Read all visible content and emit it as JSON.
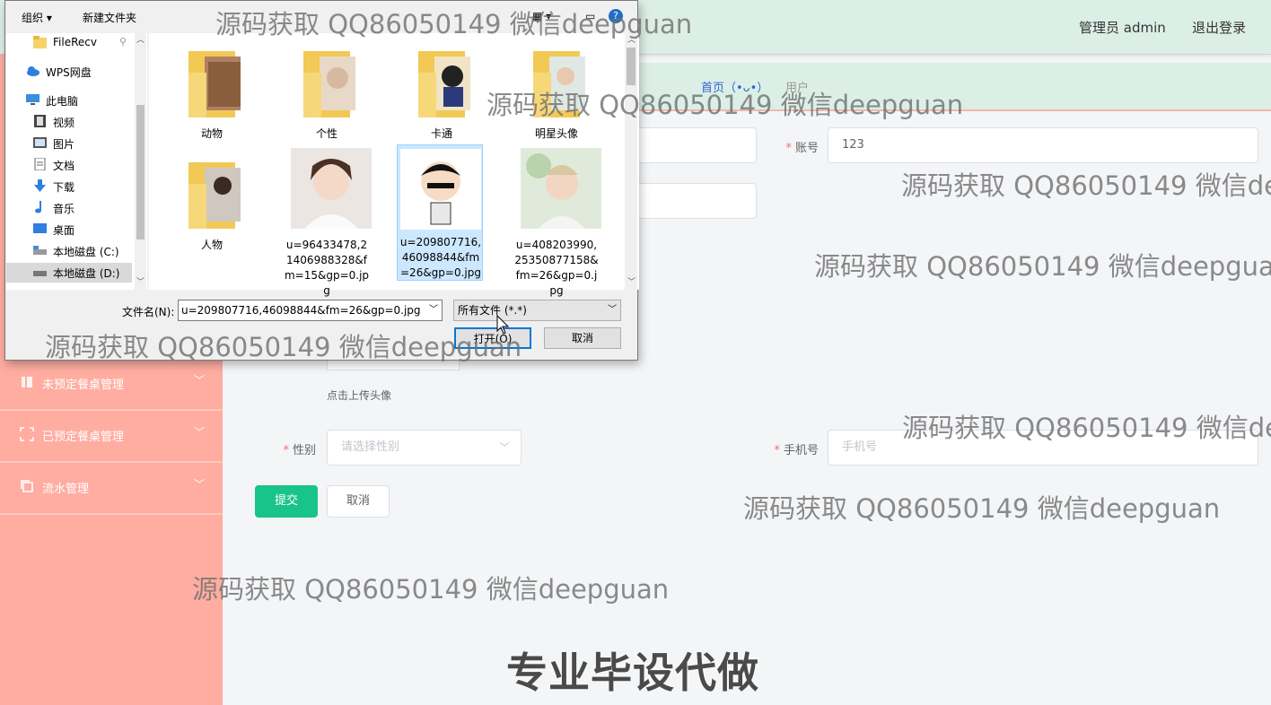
{
  "header": {
    "admin_label": "管理员 admin",
    "logout": "退出登录"
  },
  "breadcrumb": {
    "home": "首页（•ᴗ•）",
    "current": "用户"
  },
  "sidebar": {
    "items": [
      {
        "label": "未预定餐桌管理",
        "icon": "book-icon"
      },
      {
        "label": "已预定餐桌管理",
        "icon": "scan-icon"
      },
      {
        "label": "流水管理",
        "icon": "copy-icon"
      }
    ]
  },
  "form": {
    "account_label": "账号",
    "account_value": "123",
    "upload_hint": "点击上传头像",
    "gender_label": "性别",
    "gender_placeholder": "请选择性别",
    "phone_label": "手机号",
    "phone_placeholder": "手机号",
    "submit": "提交",
    "cancel": "取消"
  },
  "file_dialog": {
    "toolbar": {
      "organize": "组织",
      "new_folder": "新建文件夹"
    },
    "nav": [
      {
        "label": "FileRecv",
        "icon": "folder-icon"
      },
      {
        "label": "WPS网盘",
        "icon": "cloud-icon"
      },
      {
        "label": "此电脑",
        "icon": "computer-icon"
      },
      {
        "label": "视频",
        "icon": "video-icon"
      },
      {
        "label": "图片",
        "icon": "picture-icon"
      },
      {
        "label": "文档",
        "icon": "document-icon"
      },
      {
        "label": "下载",
        "icon": "download-icon"
      },
      {
        "label": "音乐",
        "icon": "music-icon"
      },
      {
        "label": "桌面",
        "icon": "desktop-icon"
      },
      {
        "label": "本地磁盘 (C:)",
        "icon": "drive-icon"
      },
      {
        "label": "本地磁盘 (D:)",
        "icon": "drive-icon"
      }
    ],
    "files": [
      {
        "name": "动物",
        "kind": "folder"
      },
      {
        "name": "个性",
        "kind": "folder"
      },
      {
        "name": "卡通",
        "kind": "folder"
      },
      {
        "name": "明星头像",
        "kind": "folder"
      },
      {
        "name": "人物",
        "kind": "folder"
      },
      {
        "name": "u=96433478,21406988328&fm=15&gp=0.jpg",
        "kind": "image"
      },
      {
        "name": "u=209807716,46098844&fm=26&gp=0.jpg",
        "kind": "image",
        "selected": true
      },
      {
        "name": "u=408203990,25350877158&fm=26&gp=0.jpg",
        "kind": "image"
      }
    ],
    "filename_label": "文件名(N):",
    "filename_value": "u=209807716,46098844&fm=26&gp=0.jpg",
    "filetype_value": "所有文件 (*.*)",
    "open_button": "打开(O)",
    "cancel_button": "取消"
  },
  "watermark": {
    "text": "源码获取 QQ86050149 微信deepguan",
    "banner": "专业毕设代做"
  },
  "colors": {
    "sidebar": "#ffada1",
    "header": "#dcefe6",
    "primary": "#19c48a",
    "link": "#2f62d9"
  }
}
